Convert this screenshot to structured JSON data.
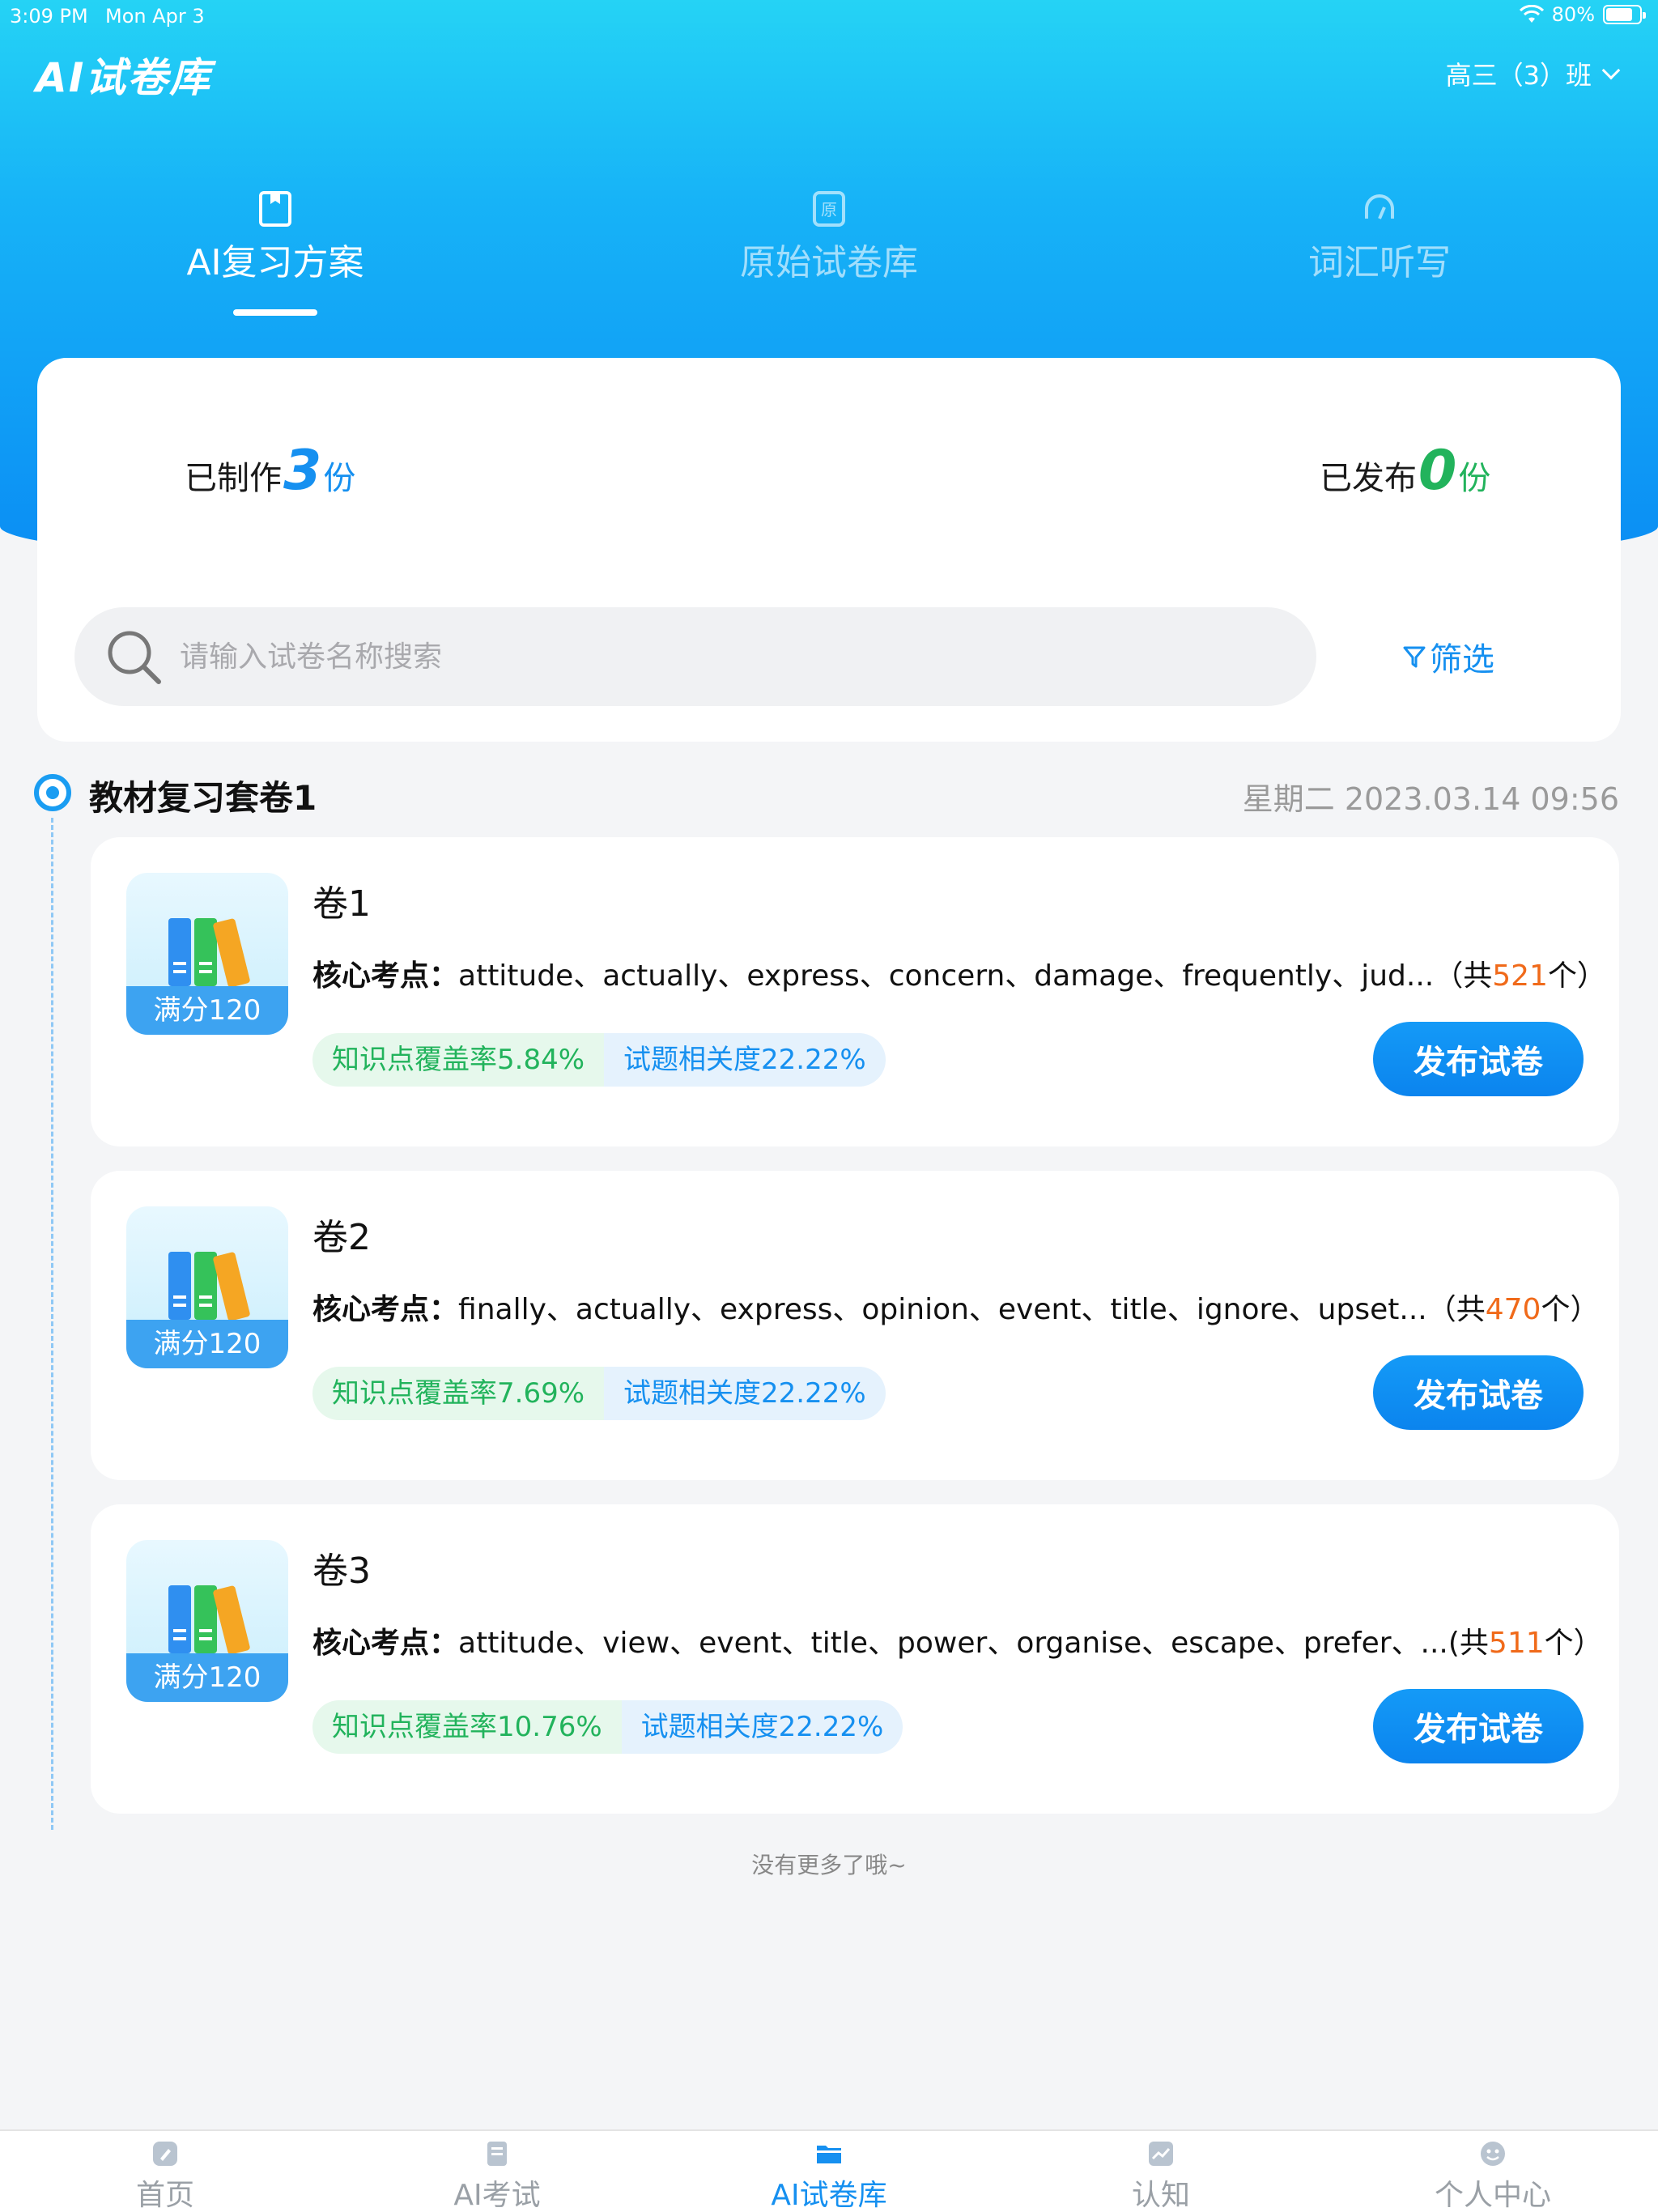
{
  "status_bar": {
    "time": "3:09 PM",
    "date": "Mon Apr 3",
    "battery": "80%",
    "battery_level": 0.8
  },
  "header": {
    "title": "AI试卷库",
    "class_selector": "高三（3）班"
  },
  "top_tabs": [
    {
      "label": "AI复习方案",
      "icon": "bookmark-icon",
      "active": true
    },
    {
      "label": "原始试卷库",
      "icon": "original-doc-icon",
      "active": false
    },
    {
      "label": "词汇听写",
      "icon": "headphones-icon",
      "active": false
    }
  ],
  "summary": {
    "made_prefix": "已制作",
    "made_count": "3",
    "made_unit": "份",
    "published_prefix": "已发布",
    "published_count": "0",
    "published_unit": "份"
  },
  "search": {
    "placeholder": "请输入试卷名称搜索",
    "value": ""
  },
  "filter_label": "筛选",
  "group": {
    "title": "教材复习套卷1",
    "date": "星期二 2023.03.14 09:56"
  },
  "papers": [
    {
      "title": "卷1",
      "score_label": "满分120",
      "keys_label": "核心考点：",
      "keys": "attitude、actually、express、concern、damage、frequently、jud...",
      "count_prefix": "（共",
      "count": "521",
      "count_suffix": "个）",
      "coverage": "知识点覆盖率5.84%",
      "relevance": "试题相关度22.22%",
      "button": "发布试卷"
    },
    {
      "title": "卷2",
      "score_label": "满分120",
      "keys_label": "核心考点：",
      "keys": "finally、actually、express、opinion、event、title、ignore、upset...",
      "count_prefix": "（共",
      "count": "470",
      "count_suffix": "个）",
      "coverage": "知识点覆盖率7.69%",
      "relevance": "试题相关度22.22%",
      "button": "发布试卷"
    },
    {
      "title": "卷3",
      "score_label": "满分120",
      "keys_label": "核心考点：",
      "keys": "attitude、view、event、title、power、organise、escape、prefer、...",
      "count_prefix": "(共",
      "count": "511",
      "count_suffix": "个）",
      "coverage": "知识点覆盖率10.76%",
      "relevance": "试题相关度22.22%",
      "button": "发布试卷"
    }
  ],
  "no_more": "没有更多了哦~",
  "bottom_nav": [
    {
      "label": "首页",
      "icon": "home-icon",
      "active": false
    },
    {
      "label": "AI考试",
      "icon": "exam-icon",
      "active": false
    },
    {
      "label": "AI试卷库",
      "icon": "folder-icon",
      "active": true
    },
    {
      "label": "认知",
      "icon": "chart-icon",
      "active": false
    },
    {
      "label": "个人中心",
      "icon": "profile-icon",
      "active": false
    }
  ],
  "colors": {
    "primary": "#1690f0",
    "green": "#22b35c",
    "orange": "#f06a1a"
  }
}
